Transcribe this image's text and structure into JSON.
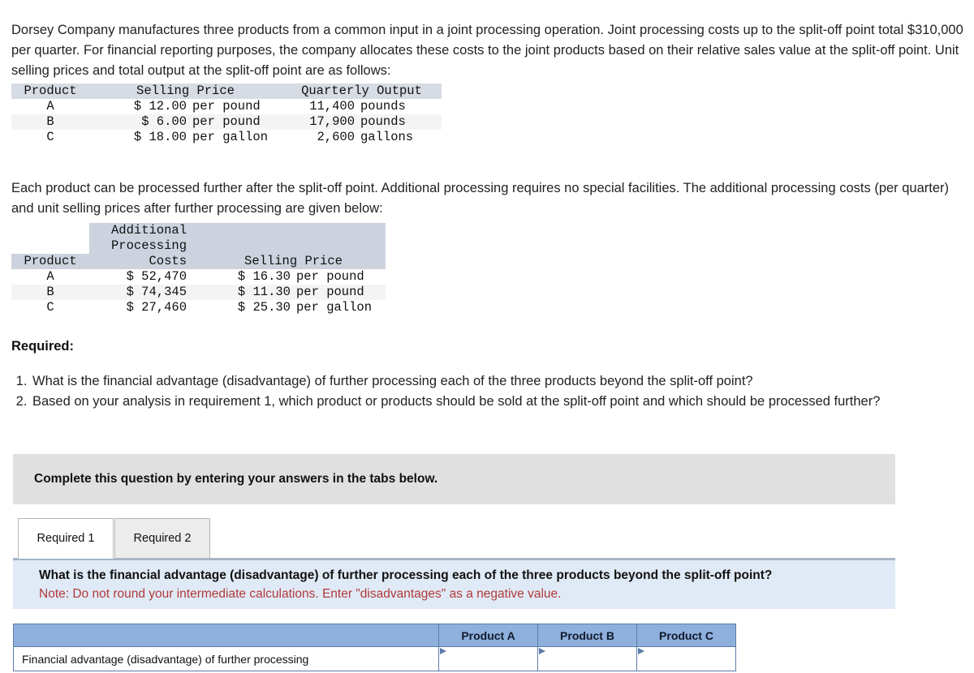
{
  "problem": {
    "intro": "Dorsey Company manufactures three products from a common input in a joint processing operation. Joint processing costs up to the split-off point total $310,000 per quarter. For financial reporting purposes, the company allocates these costs to the joint products based on their relative sales value at the split-off point. Unit selling prices and total output at the split-off point are as follows:",
    "further": "Each product can be processed further after the split-off point. Additional processing requires no special facilities. The additional processing costs (per quarter) and unit selling prices after further processing are given below:"
  },
  "table_selling_price": {
    "headers": {
      "product": "Product",
      "selling_price": "Selling Price",
      "quarterly_output": "Quarterly Output"
    },
    "rows": [
      {
        "product": "A",
        "price_amount": "$ 12.00",
        "price_unit": "per pound",
        "output_amount": "11,400",
        "output_unit": "pounds"
      },
      {
        "product": "B",
        "price_amount": "$ 6.00",
        "price_unit": "per pound",
        "output_amount": "17,900",
        "output_unit": "pounds"
      },
      {
        "product": "C",
        "price_amount": "$ 18.00",
        "price_unit": "per gallon",
        "output_amount": "2,600",
        "output_unit": "gallons"
      }
    ]
  },
  "table_additional_processing": {
    "headers": {
      "product": "Product",
      "additional": "Additional",
      "processing": "Processing",
      "costs": "Costs",
      "selling_price": "Selling Price"
    },
    "rows": [
      {
        "product": "A",
        "cost": "$ 52,470",
        "price_amount": "$ 16.30",
        "price_unit": "per pound"
      },
      {
        "product": "B",
        "cost": "$ 74,345",
        "price_amount": "$ 11.30",
        "price_unit": "per pound"
      },
      {
        "product": "C",
        "cost": "$ 27,460",
        "price_amount": "$ 25.30",
        "price_unit": "per gallon"
      }
    ]
  },
  "required": {
    "heading": "Required:",
    "items": [
      "What is the financial advantage (disadvantage) of further processing each of the three products beyond the split-off point?",
      "Based on your analysis in requirement 1, which product or products should be sold at the split-off point and which should be processed further?"
    ]
  },
  "instruction_banner": {
    "text": "Complete this question by entering your answers in the tabs below."
  },
  "tabs": [
    {
      "label": "Required 1",
      "active": true
    },
    {
      "label": "Required 2",
      "active": false
    }
  ],
  "question_box": {
    "question": "What is the financial advantage (disadvantage) of further processing each of the three products beyond the split-off point?",
    "note": "Note: Do not round your intermediate calculations. Enter \"disadvantages\" as a negative value.",
    "note_color": "#b03a3a"
  },
  "answer_table": {
    "headers": [
      "",
      "Product A",
      "Product B",
      "Product C"
    ],
    "row_label": "Financial advantage (disadvantage) of further processing",
    "values": [
      "",
      "",
      ""
    ]
  },
  "colors": {
    "table_header_bg": "#d6dbe4",
    "table_header_bg_2": "#ccd3de",
    "banner_bg": "#e0e0e0",
    "question_bg": "#e0eaf6",
    "answer_header_bg": "#8fb0dd",
    "answer_border": "#5b7ba8"
  }
}
